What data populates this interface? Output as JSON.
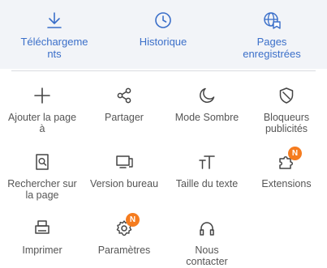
{
  "top_actions": [
    {
      "label": "Téléchargeme\nnts",
      "icon": "download-icon"
    },
    {
      "label": "Historique",
      "icon": "clock-icon"
    },
    {
      "label": "Pages\nenregistrées",
      "icon": "saved-globe-icon"
    }
  ],
  "menu": [
    {
      "label": "Ajouter la page\nà",
      "icon": "plus-icon"
    },
    {
      "label": "Partager",
      "icon": "share-icon"
    },
    {
      "label": "Mode Sombre",
      "icon": "moon-icon"
    },
    {
      "label": "Bloqueurs\npublicités",
      "icon": "shield-icon"
    },
    {
      "label": "Rechercher sur\nla page",
      "icon": "find-in-page-icon"
    },
    {
      "label": "Version bureau",
      "icon": "desktop-icon"
    },
    {
      "label": "Taille du texte",
      "icon": "text-size-icon"
    },
    {
      "label": "Extensions",
      "icon": "puzzle-icon",
      "badge": "N"
    },
    {
      "label": "Imprimer",
      "icon": "printer-icon"
    },
    {
      "label": "Paramètres",
      "icon": "gear-icon",
      "badge": "N"
    },
    {
      "label": "Nous\ncontacter",
      "icon": "headset-icon"
    }
  ],
  "colors": {
    "accent": "#3b6fc9",
    "badge": "#f57c1f",
    "top_background": "#f2f4f8"
  }
}
